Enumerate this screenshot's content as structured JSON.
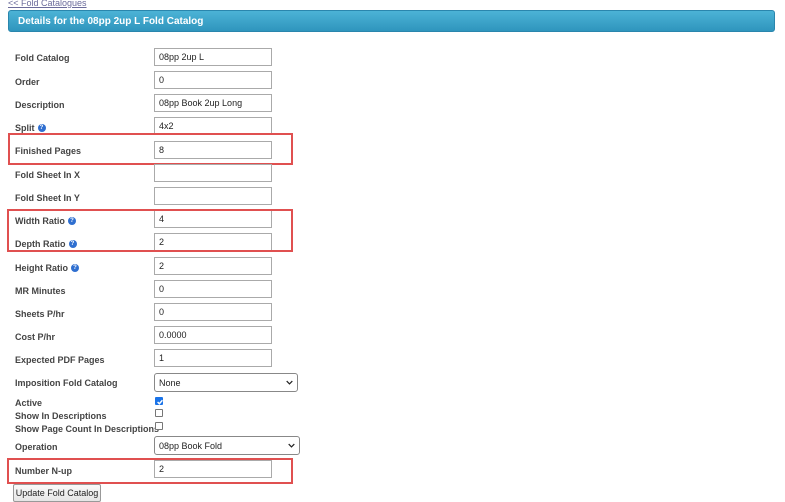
{
  "back_link": "<< Fold Catalogues",
  "title": "Details for the 08pp 2up L Fold Catalog",
  "fields": [
    {
      "label": "Fold Catalog",
      "value": "08pp 2up L"
    },
    {
      "label": "Order",
      "value": "0"
    },
    {
      "label": "Description",
      "value": "08pp Book 2up Long"
    },
    {
      "label": "Split",
      "value": "4x2"
    },
    {
      "label": "Finished Pages",
      "value": "8"
    },
    {
      "label": "Fold Sheet In X",
      "value": ""
    },
    {
      "label": "Fold Sheet In Y",
      "value": ""
    },
    {
      "label": "Width Ratio",
      "value": "4"
    },
    {
      "label": "Depth Ratio",
      "value": "2"
    },
    {
      "label": "Height Ratio",
      "value": "2"
    },
    {
      "label": "MR Minutes",
      "value": "0"
    },
    {
      "label": "Sheets P/hr",
      "value": "0"
    },
    {
      "label": "Cost P/hr",
      "value": "0.0000"
    },
    {
      "label": "Expected PDF Pages",
      "value": "1"
    }
  ],
  "imposition": {
    "label": "Imposition Fold Catalog",
    "value": "None"
  },
  "active": {
    "label": "Active",
    "checked": true
  },
  "show_in_descriptions": {
    "label": "Show In Descriptions",
    "checked": false
  },
  "show_page_count": {
    "label": "Show Page Count In Descriptions",
    "checked": false
  },
  "operation": {
    "label": "Operation",
    "value": "08pp Book Fold"
  },
  "number_nup": {
    "label": "Number N-up",
    "value": "2"
  },
  "update_button": "Update Fold Catalog",
  "help_glyph": "?",
  "colors": {
    "title_bar": "#3aa3c9",
    "highlight": "#e05050",
    "help_icon": "#2f6fd0",
    "checkbox": "#1a73e8"
  }
}
